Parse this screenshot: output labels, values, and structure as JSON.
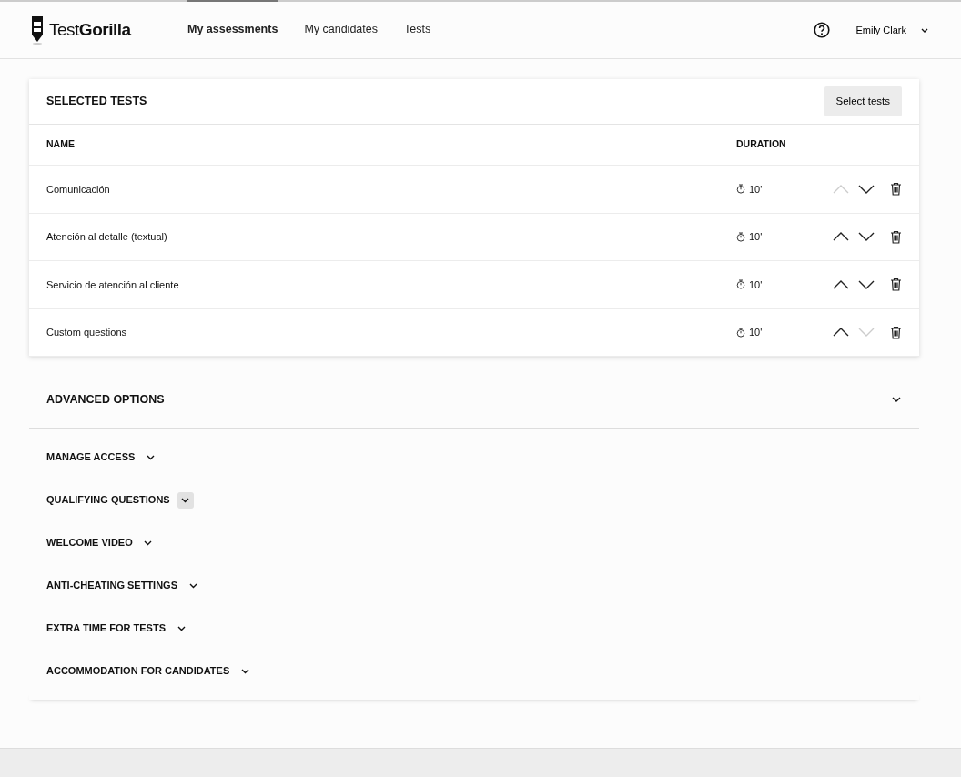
{
  "header": {
    "logo_light": "Test",
    "logo_bold": "Gorilla",
    "nav": [
      {
        "label": "My assessments",
        "selected": true
      },
      {
        "label": "My candidates",
        "selected": false
      },
      {
        "label": "Tests",
        "selected": false
      }
    ],
    "user": "Emily Clark"
  },
  "selected_tests": {
    "title": "SELECTED TESTS",
    "button": "Select tests",
    "columns": [
      "NAME",
      "DURATION"
    ],
    "rows": [
      {
        "name": "Comunicación",
        "duration": "10'",
        "up_disabled": true,
        "down_disabled": false
      },
      {
        "name": "Atención al detalle (textual)",
        "duration": "10'",
        "up_disabled": false,
        "down_disabled": false
      },
      {
        "name": "Servicio de atención al cliente",
        "duration": "10'",
        "up_disabled": false,
        "down_disabled": false
      },
      {
        "name": "Custom questions",
        "duration": "10'",
        "up_disabled": false,
        "down_disabled": true
      }
    ]
  },
  "advanced_options": {
    "title": "ADVANCED OPTIONS",
    "expanded": true,
    "options": [
      {
        "label": "MANAGE ACCESS",
        "hovered": false
      },
      {
        "label": "QUALIFYING QUESTIONS",
        "hovered": true
      },
      {
        "label": "WELCOME VIDEO",
        "hovered": false
      },
      {
        "label": "ANTI-CHEATING SETTINGS",
        "hovered": false
      },
      {
        "label": "EXTRA TIME FOR TESTS",
        "hovered": false
      },
      {
        "label": "ACCOMMODATION FOR CANDIDATES",
        "hovered": false
      }
    ]
  }
}
